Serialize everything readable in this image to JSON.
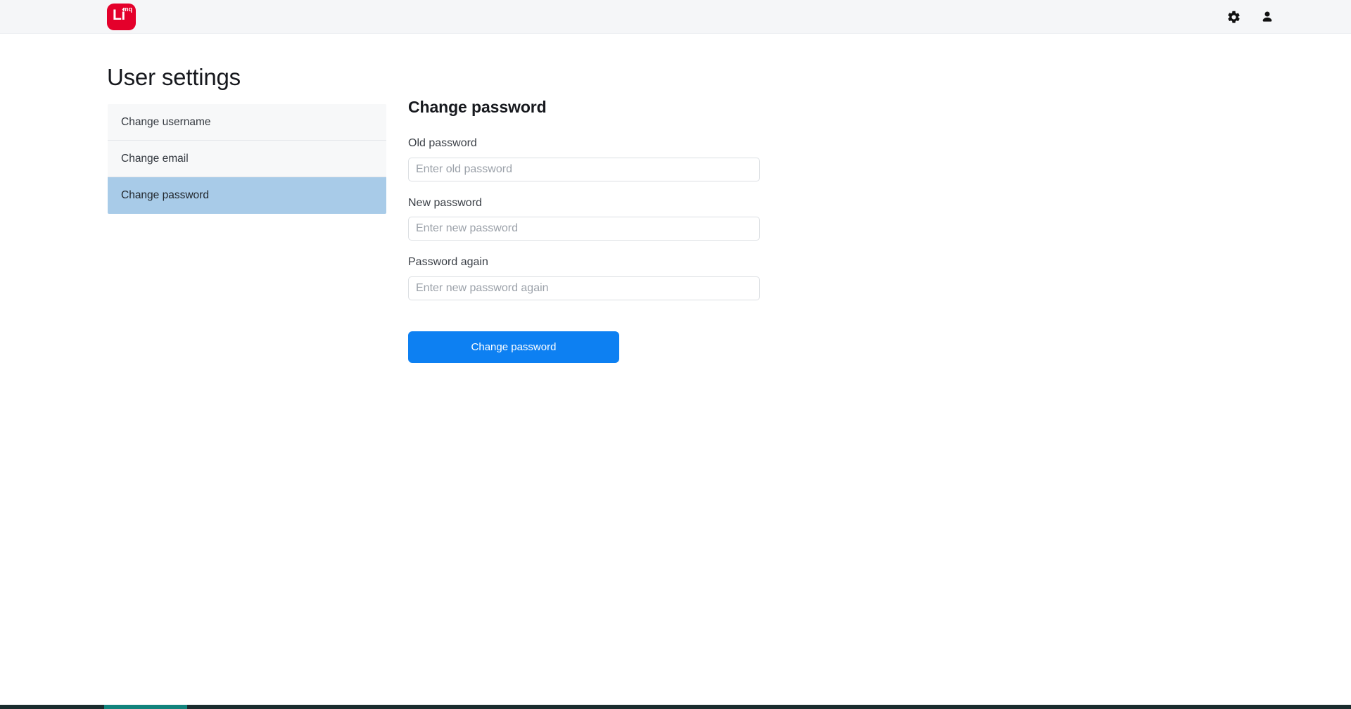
{
  "topbar": {
    "logo": {
      "primary_text": "Li",
      "superscript_text": "mq",
      "background_color": "#e4002b",
      "text_color": "#ffffff"
    },
    "actions": [
      {
        "name": "settings-button",
        "icon": "gear-icon",
        "label": "Settings"
      },
      {
        "name": "account-button",
        "icon": "user-icon",
        "label": "Account"
      }
    ],
    "background_color": "#f5f6f8"
  },
  "page": {
    "title": "User settings"
  },
  "settings_nav": {
    "items": [
      {
        "label": "Change username",
        "active": false
      },
      {
        "label": "Change email",
        "active": false
      },
      {
        "label": "Change password",
        "active": true
      }
    ],
    "active_background_color": "#a8cbe8",
    "item_background_color": "#f7f8f9"
  },
  "form": {
    "title": "Change password",
    "fields": [
      {
        "label": "Old password",
        "placeholder": "Enter old password",
        "value": ""
      },
      {
        "label": "New password",
        "placeholder": "Enter new password",
        "value": ""
      },
      {
        "label": "Password again",
        "placeholder": "Enter new password again",
        "value": ""
      }
    ],
    "submit_label": "Change password",
    "submit_color": "#0d80f2"
  },
  "bottom_strip": {
    "background_color": "#1b2c2e",
    "accent_color": "#12837c"
  }
}
